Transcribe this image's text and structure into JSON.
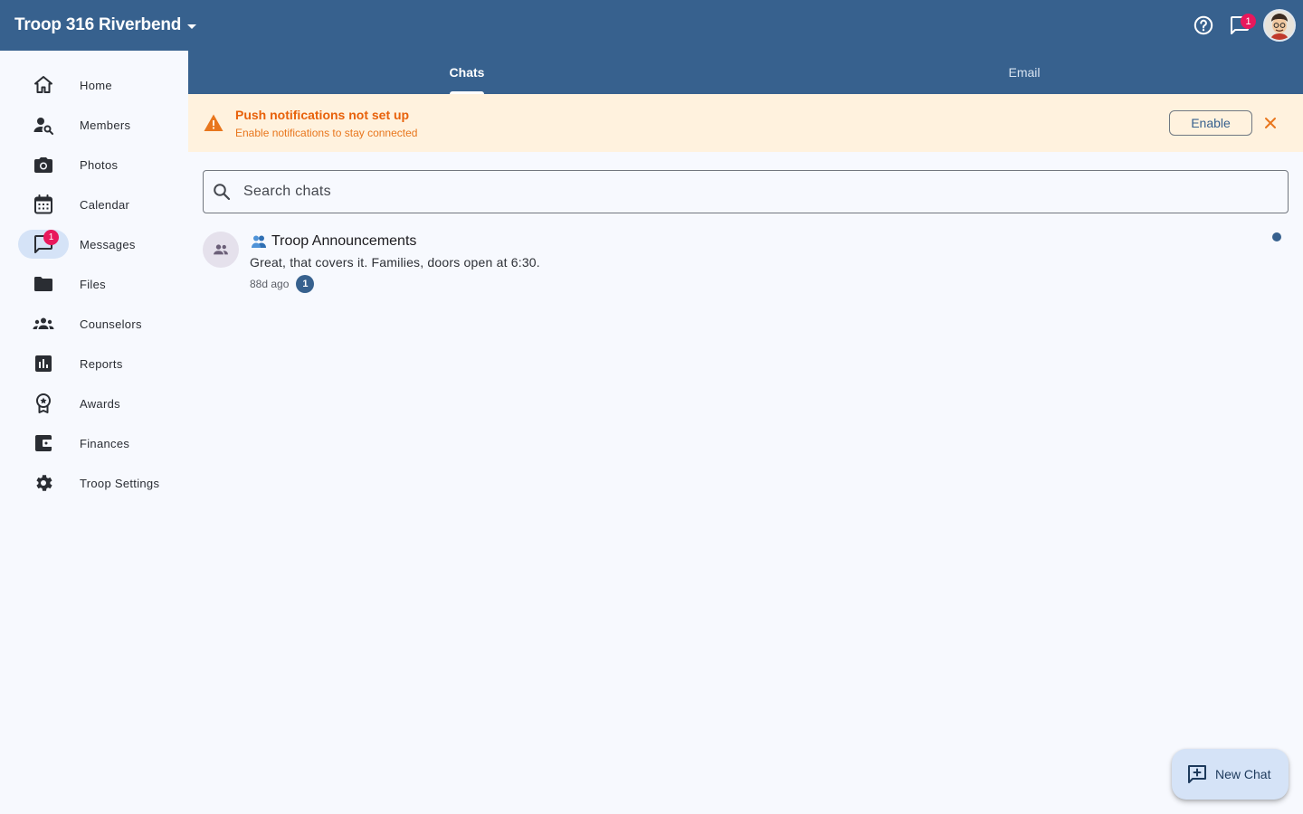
{
  "app": {
    "troop_name": "Troop 316 Riverbend",
    "notifications_count": "1"
  },
  "tabs": [
    {
      "label": "Chats",
      "active": true
    },
    {
      "label": "Email",
      "active": false
    }
  ],
  "sidebar": {
    "items": [
      {
        "label": "Home",
        "icon": "home-icon"
      },
      {
        "label": "Members",
        "icon": "person-search-icon"
      },
      {
        "label": "Photos",
        "icon": "camera-icon"
      },
      {
        "label": "Calendar",
        "icon": "calendar-icon"
      },
      {
        "label": "Messages",
        "icon": "chat-icon",
        "badge": "1",
        "active": true
      },
      {
        "label": "Files",
        "icon": "folder-icon"
      },
      {
        "label": "Counselors",
        "icon": "groups-icon"
      },
      {
        "label": "Reports",
        "icon": "bar-chart-icon"
      },
      {
        "label": "Awards",
        "icon": "award-icon"
      },
      {
        "label": "Finances",
        "icon": "wallet-icon"
      },
      {
        "label": "Troop Settings",
        "icon": "gear-icon"
      }
    ]
  },
  "banner": {
    "title": "Push notifications not set up",
    "subtitle": "Enable notifications to stay connected",
    "enable_label": "Enable"
  },
  "search": {
    "placeholder": "Search chats",
    "value": ""
  },
  "chats": [
    {
      "emoji": "👥",
      "title": "Troop Announcements",
      "preview": "Great, that covers it. Families, doors open at 6:30.",
      "time": "88d ago",
      "unread_count": "1"
    }
  ],
  "fab": {
    "label": "New Chat"
  },
  "colors": {
    "primary": "#37618e",
    "background": "#f7f9fe",
    "badge": "#e8185c",
    "warning_bg": "#fff2de",
    "warning_text": "#e8610a",
    "active_pill": "#d5e3f7"
  }
}
